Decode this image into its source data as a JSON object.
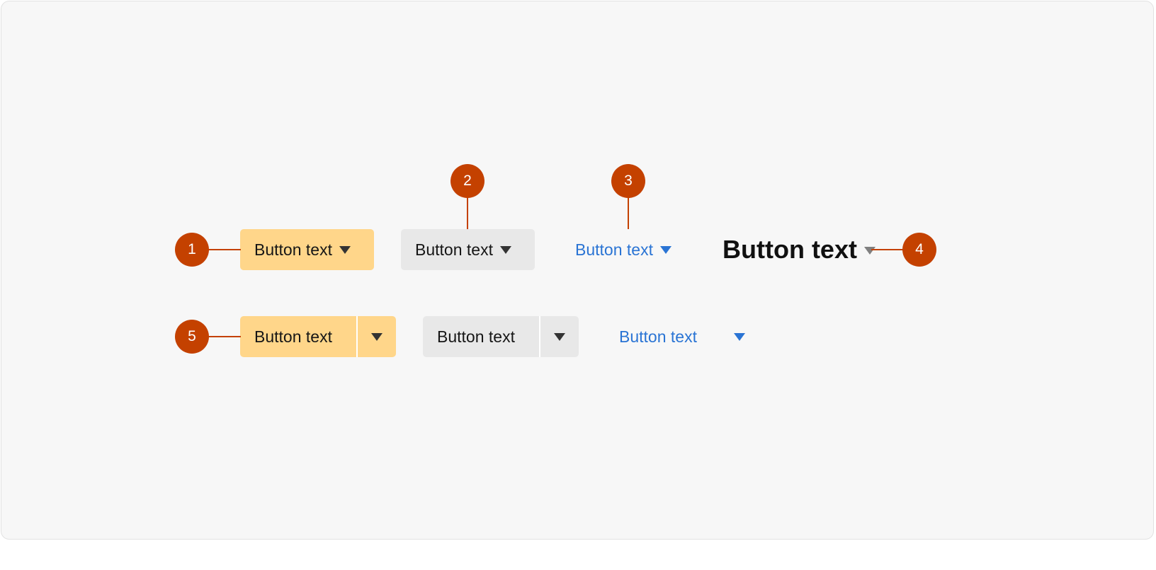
{
  "row1": {
    "primary_dropdown": {
      "label": "Button text",
      "caret": "caret-down-icon"
    },
    "secondary_dropdown": {
      "label": "Button text",
      "caret": "caret-down-icon"
    },
    "link_dropdown": {
      "label": "Button text",
      "caret": "caret-down-icon"
    },
    "heading_dropdown": {
      "label": "Button text",
      "caret": "caret-down-icon"
    }
  },
  "row2": {
    "primary_split": {
      "label": "Button text",
      "caret": "caret-down-icon"
    },
    "secondary_split": {
      "label": "Button text",
      "caret": "caret-down-icon"
    },
    "link_split": {
      "label": "Button text",
      "caret": "caret-down-icon"
    }
  },
  "callouts": [
    "1",
    "2",
    "3",
    "4",
    "5"
  ],
  "colors": {
    "panel_background": "#f7f7f7",
    "primary_fill": "#ffd68a",
    "secondary_fill": "#e8e8e8",
    "link_text": "#2a74d4",
    "callout": "#c44100"
  }
}
